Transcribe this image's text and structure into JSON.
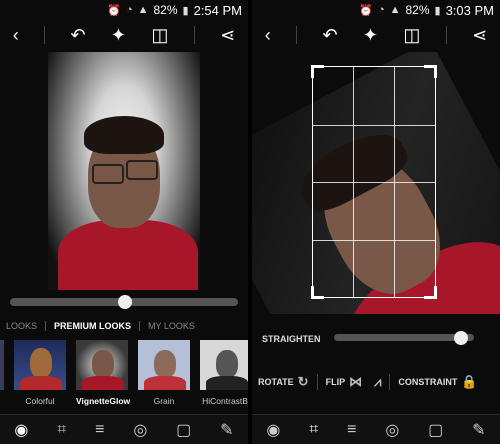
{
  "left": {
    "status": {
      "battery": "82%",
      "time": "2:54 PM"
    },
    "looks_tabs": [
      "LOOKS",
      "PREMIUM LOOKS",
      "MY LOOKS"
    ],
    "looks": [
      {
        "label": ""
      },
      {
        "label": "Colorful"
      },
      {
        "label": "VignetteGlow"
      },
      {
        "label": "Grain"
      },
      {
        "label": "HiContrastBl"
      }
    ]
  },
  "right": {
    "status": {
      "battery": "82%",
      "time": "3:03 PM"
    },
    "straighten_label": "STRAIGHTEN",
    "rotate_label": "ROTATE",
    "flip_label": "FLIP",
    "constraint_label": "CONSTRAINT"
  },
  "icons": {
    "back": "‹",
    "undo": "↶",
    "auto-fix": "✦",
    "compare": "◫",
    "share": "⋖",
    "looks": "◉",
    "crop": "⌗",
    "adjust": "≡",
    "eye": "◎",
    "frame": "▢",
    "heal": "✎"
  }
}
